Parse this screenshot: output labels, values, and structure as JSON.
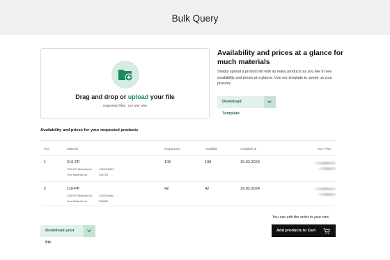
{
  "header": {
    "title": "Bulk Query"
  },
  "upload": {
    "drop_prefix": "Drag and drop or ",
    "drop_link": "upload",
    "drop_suffix": " your file",
    "supported": "Supported files: .csv and .xlsx"
  },
  "promo": {
    "title": "Availability and prices at a glance for much materials",
    "description": "Simply upload a product list with as many products as you like to see availability and prices at a glance. Use our template to speed up your process.",
    "template_button": "Download Template"
  },
  "results": {
    "title": "Availability and prices for your requested products",
    "columns": [
      "Pos",
      "Material",
      "Requested",
      "Available",
      "Available at",
      "Your Price"
    ],
    "rows": [
      {
        "pos": "1",
        "material": "216-PP",
        "stauff_label": "STAUFF Material No.",
        "stauff_no": "1130006333",
        "your_label": "Your Material No.",
        "your_no": "935733",
        "requested": "100",
        "available": "100",
        "available_at": "19.02.2024"
      },
      {
        "pos": "2",
        "material": "110-PP",
        "stauff_label": "STAUFF Material No.",
        "stauff_no": "1130002680",
        "your_label": "Your Material No.",
        "your_no": "536686",
        "requested": "42",
        "available": "42",
        "available_at": "19.02.2024"
      }
    ]
  },
  "footer": {
    "download_button": "Download your file",
    "cart_note": "You can edit the order in your cart.",
    "cart_button": "Add products to Cart"
  },
  "colors": {
    "accent": "#1d8a5a",
    "button_bg": "#e3f1eb",
    "cart_bg": "#111111"
  }
}
